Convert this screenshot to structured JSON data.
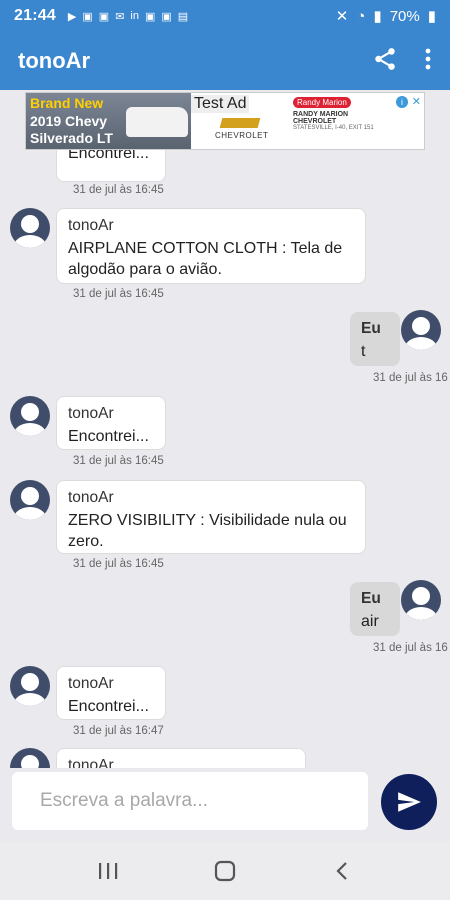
{
  "status_bar": {
    "time": "21:44",
    "battery": "70%",
    "icons": [
      "play-icon",
      "square-icon",
      "square-icon",
      "mail-icon",
      "linkedin-icon",
      "square-icon",
      "square-icon",
      "image-icon"
    ]
  },
  "app_bar": {
    "title": "tonoAr",
    "color": "#3b87cf"
  },
  "ad": {
    "left_line1": "Brand New",
    "left_line2": "2019 Chevy",
    "left_line3": "Silverado LT",
    "test_label": "Test Ad",
    "brand": "CHEVROLET",
    "dealer_logo": "Randy Marion",
    "dealer_line1": "RANDY MARION",
    "dealer_line2": "CHEVROLET",
    "dealer_line3": "STATESVILLE, I-40, EXIT 151"
  },
  "messages": [
    {
      "type": "received",
      "sender": "",
      "text": "Encontrei...",
      "time": "31 de jul às 16:45"
    },
    {
      "type": "received",
      "sender": "tonoAr",
      "text": "AIRPLANE COTTON CLOTH :  Tela de algodão para o avião.",
      "time": "31 de jul às 16:45"
    },
    {
      "type": "sent",
      "sender": "Eu",
      "text": "t",
      "time": "31 de jul às 16"
    },
    {
      "type": "received",
      "sender": "tonoAr",
      "text": "Encontrei...",
      "time": "31 de jul às 16:45"
    },
    {
      "type": "received",
      "sender": "tonoAr",
      "text": "ZERO VISIBILITY :  Visibilidade nula ou zero.",
      "time": "31 de jul às 16:45"
    },
    {
      "type": "sent",
      "sender": "Eu",
      "text": "air",
      "time": "31 de jul às 16"
    },
    {
      "type": "received",
      "sender": "tonoAr",
      "text": "Encontrei...",
      "time": "31 de jul às 16:47"
    },
    {
      "type": "received",
      "sender": "tonoAr",
      "text": "",
      "time": ""
    }
  ],
  "input": {
    "placeholder": "Escreva a palavra..."
  },
  "colors": {
    "accent": "#3b87cf",
    "send_button": "#0e1f5b",
    "background": "#e9e9ee",
    "avatar": "#3f4d6a"
  }
}
